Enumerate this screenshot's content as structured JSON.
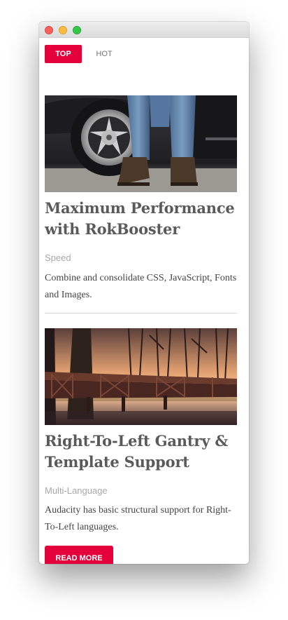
{
  "tabs": [
    {
      "label": "TOP",
      "active": true
    },
    {
      "label": "HOT",
      "active": false
    }
  ],
  "articles": [
    {
      "image": "car-wheel-and-jeans-photo",
      "title": "Maximum Performance with RokBooster",
      "category": "Speed",
      "description": "Combine and consolidate CSS, JavaScript, Fonts and Images."
    },
    {
      "image": "wooden-bridge-sunset-photo",
      "title": "Right-To-Left Gantry & Template Support",
      "category": "Multi-Language",
      "description": "Audacity has basic structural support for Right-To-Left languages."
    }
  ],
  "read_more": {
    "label": "READ MORE"
  },
  "colors": {
    "accent": "#e4003b",
    "title": "#5a5a5a",
    "category": "#a8a8a8",
    "text": "#444444"
  }
}
